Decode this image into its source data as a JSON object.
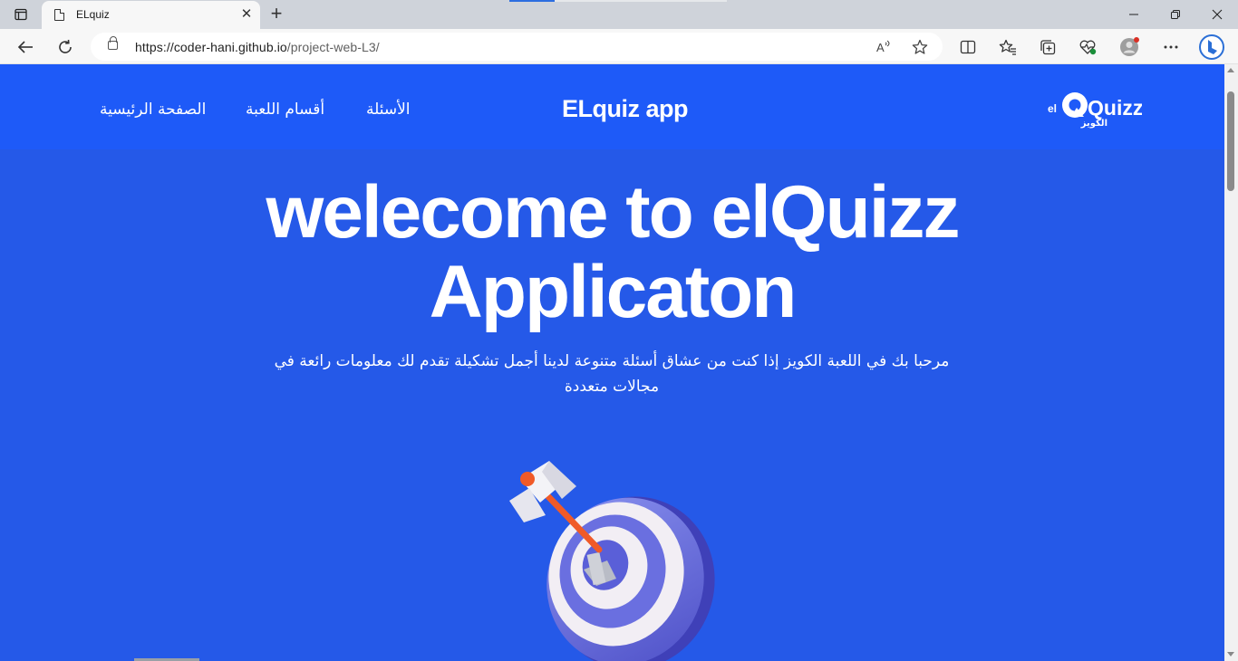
{
  "browser": {
    "tab_title": "ELquiz",
    "url_host": "https://coder-hani.github.io",
    "url_path": "/project-web-L3/",
    "read_aloud_icon": "read-aloud-icon",
    "favorite_icon": "star-icon"
  },
  "site": {
    "nav": {
      "home": "الصفحة الرئيسية",
      "categories": "أقسام اللعبة",
      "questions": "الأسئلة"
    },
    "brand": "ELquiz app",
    "logo": {
      "prefix": "el",
      "word": "Quizz",
      "arabic": "الكويز"
    },
    "hero": {
      "title_line1": "welecome to elQuizz",
      "title_line2": "Applicaton",
      "subtitle": "مرحبا بك في اللعبة الكويز إذا كنت من عشاق أسئلة متنوعة لدينا أجمل تشكيلة تقدم لك معلومات رائعة في مجالات متعددة"
    }
  },
  "colors": {
    "header_bg": "#1e5af8",
    "page_bg": "#2559e8",
    "text": "#ffffff"
  }
}
